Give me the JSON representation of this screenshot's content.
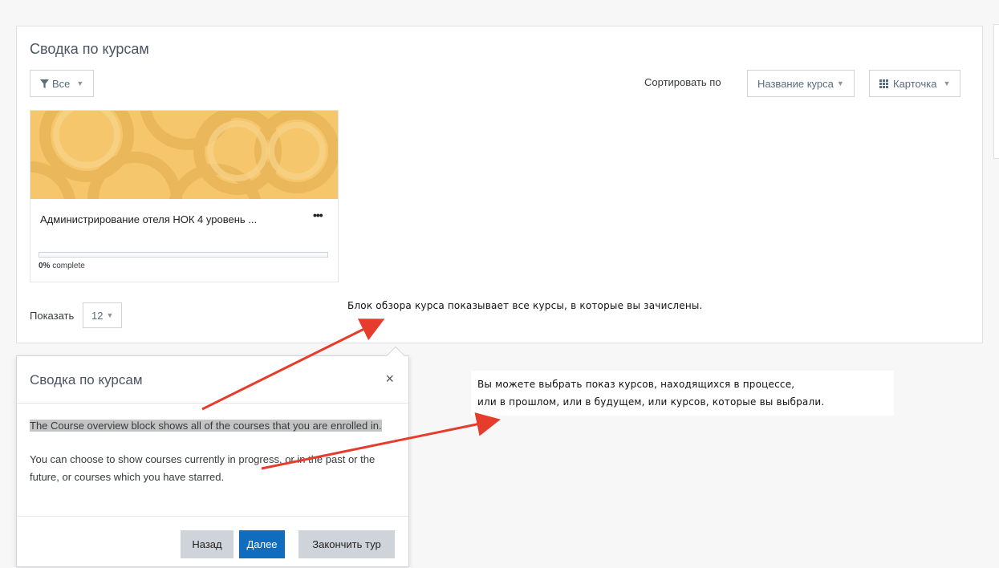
{
  "block": {
    "title": "Сводка по курсам",
    "filter_label": "Все",
    "sort_prefix": "Сортировать по",
    "sort_value": "Название курса",
    "view_value": "Карточка",
    "show_prefix": "Показать",
    "show_value": "12"
  },
  "course": {
    "name": "Администрирование отеля НОК 4 уровень ...",
    "progress_percent": 0,
    "progress_value": "0%",
    "progress_suffix": " complete",
    "menu_glyph": "•••"
  },
  "popover": {
    "title": "Сводка по курсам",
    "close_glyph": "×",
    "text1": "The Course overview block shows all of the courses that you are enrolled in.",
    "text2": "You can choose to show courses currently in progress, or in the past or the future, or courses which you have starred.",
    "back_label": "Назад",
    "next_label": "Далее",
    "end_label": "Закончить тур"
  },
  "annotations": {
    "note1": "Блок обзора курса показывает все курсы, в которые вы зачислены.",
    "note2_line1": "Вы можете выбрать показ курсов, находящихся в процессе,",
    "note2_line2": "или в прошлом, или в будущем, или курсов, которые вы выбрали.",
    "arrow_color": "#e53c2e"
  },
  "colors": {
    "primary": "#0f6cbf",
    "secondary": "#ced4da",
    "course_image": "#f5c66b"
  },
  "icons": {
    "filter": "filter-icon",
    "grid": "grid-icon",
    "caret": "caret-down-icon"
  }
}
